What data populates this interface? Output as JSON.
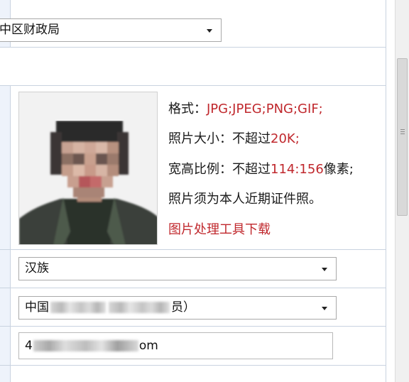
{
  "department_select": {
    "value": "中区财政局"
  },
  "photo_info": {
    "format_label": "格式：",
    "format_value": "JPG;JPEG;PNG;GIF;",
    "size_label": "照片大小：不超过",
    "size_value": "20K;",
    "ratio_label": "宽高比例：不超过",
    "ratio_value": "114:156",
    "ratio_unit": "像素;",
    "note": "照片须为本人近期证件照。",
    "tool_link": "图片处理工具下载"
  },
  "ethnicity_select": {
    "value": "汉族"
  },
  "political_select": {
    "value_prefix": "中国",
    "value_suffix": "员）"
  },
  "email_input": {
    "value_prefix": "4",
    "value_suffix": "om"
  },
  "colors": {
    "accent_red": "#c0282d",
    "border": "#c9d3e0",
    "label_bg": "#eef3fb"
  },
  "icons": {
    "dropdown": "chevron-down-icon"
  }
}
